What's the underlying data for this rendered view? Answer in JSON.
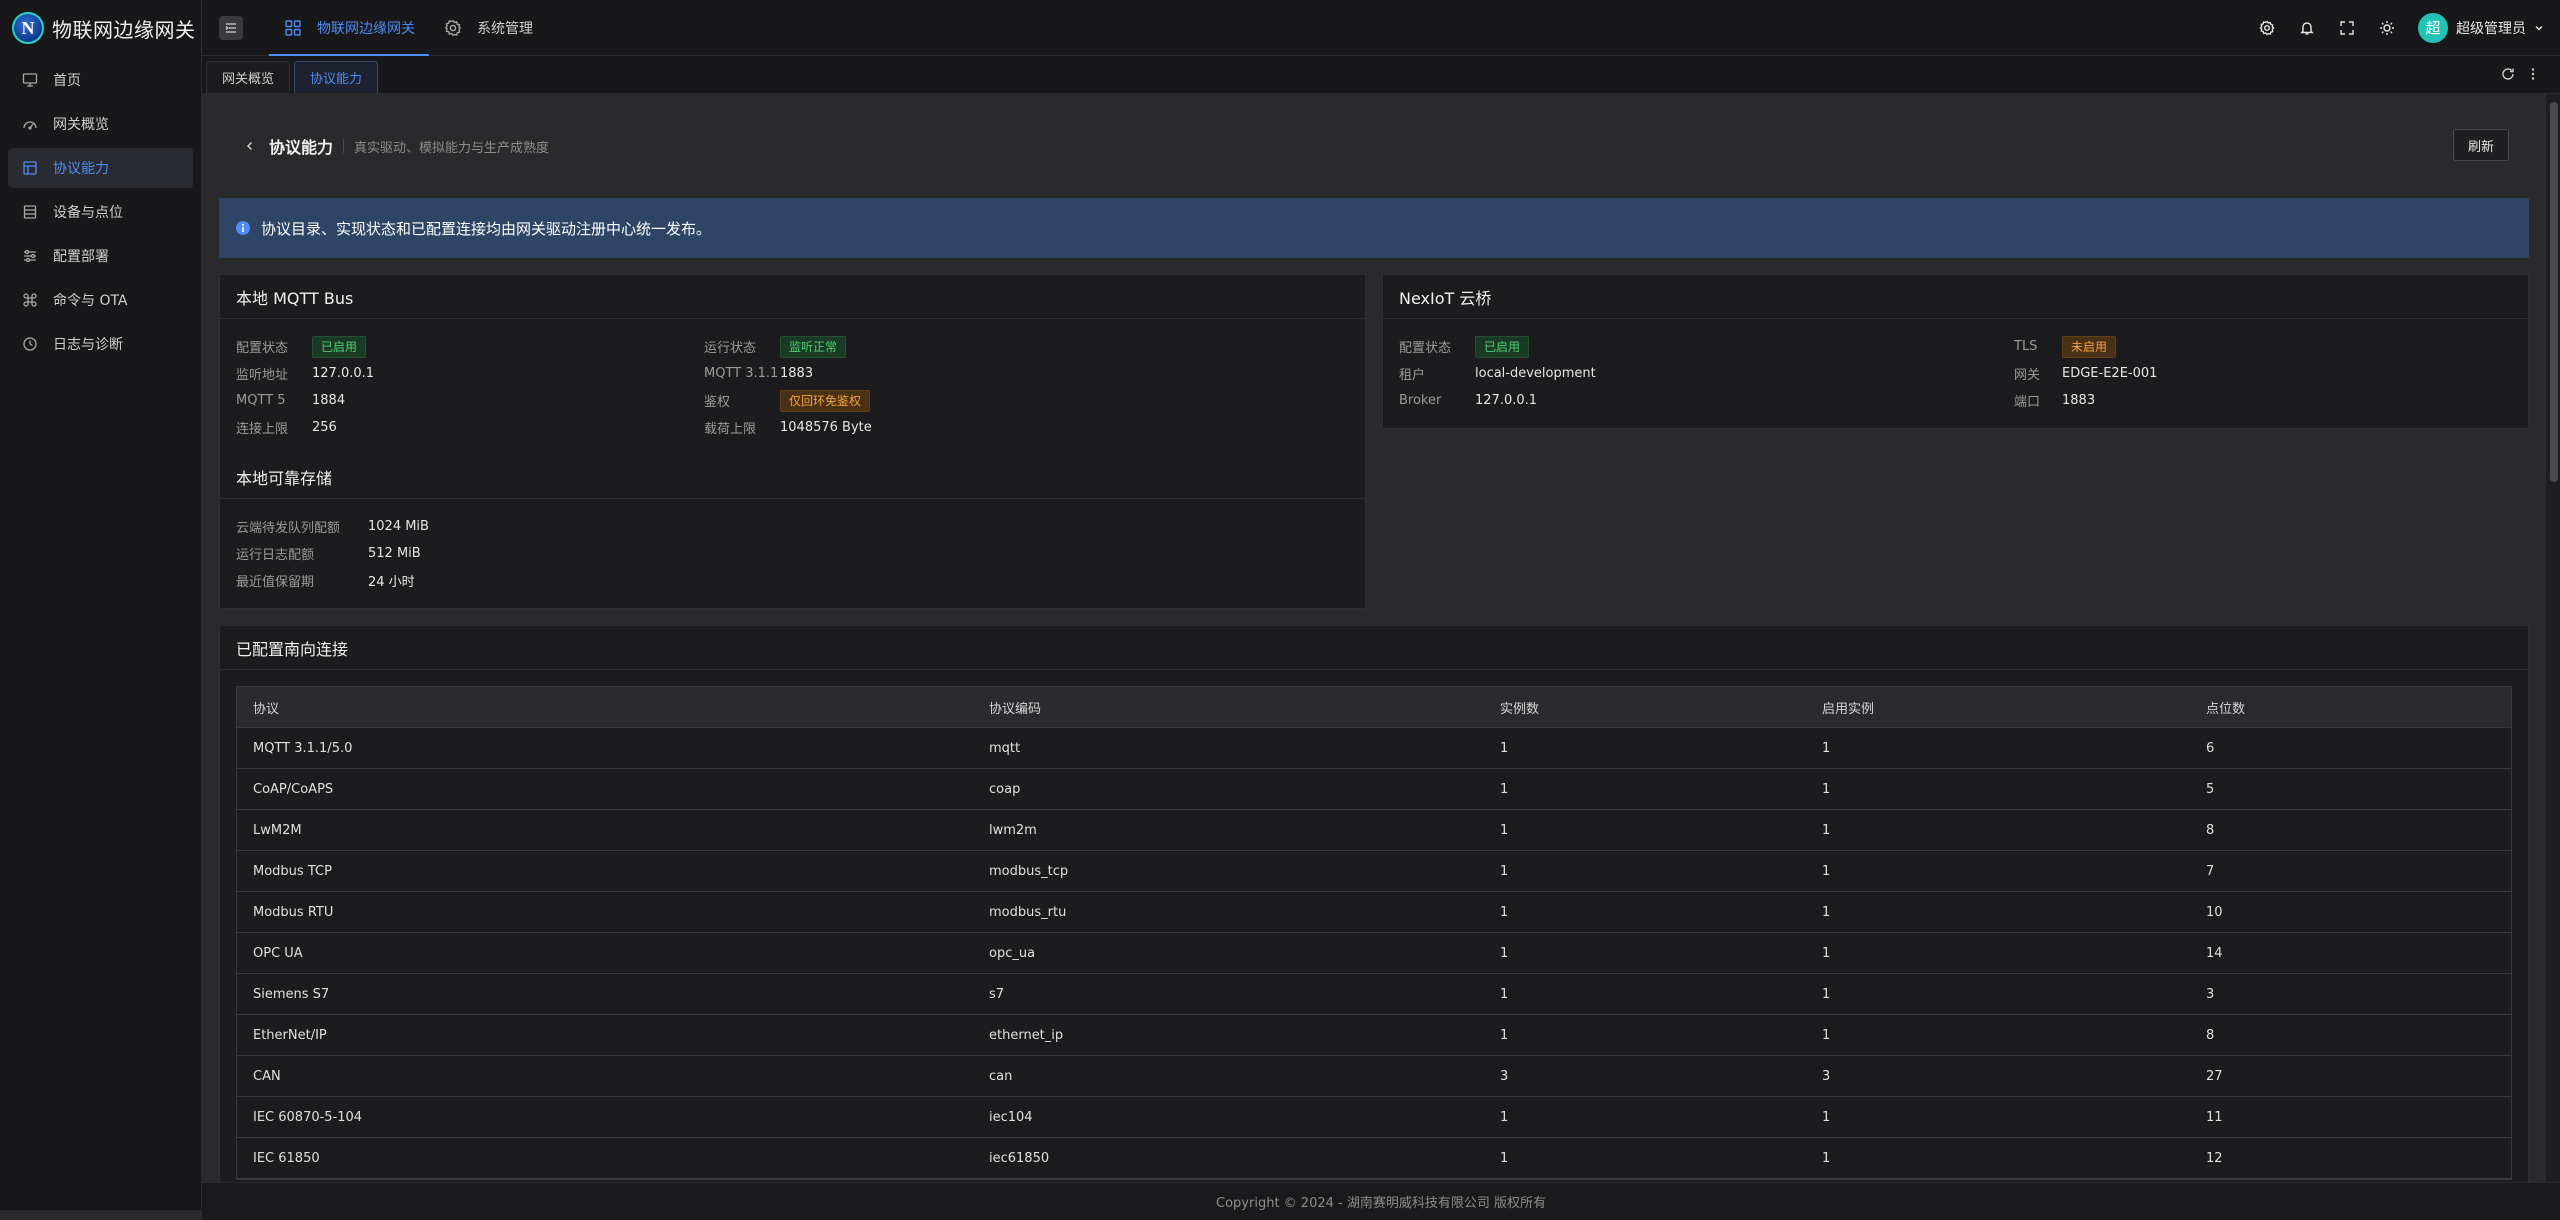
{
  "app": {
    "brand_logo_letter": "N",
    "brand_title": "物联网边缘网关"
  },
  "sidebar": {
    "items": [
      {
        "label": "首页",
        "icon": "monitor-icon"
      },
      {
        "label": "网关概览",
        "icon": "gauge-icon"
      },
      {
        "label": "协议能力",
        "icon": "layout-icon",
        "active": true
      },
      {
        "label": "设备与点位",
        "icon": "database-icon"
      },
      {
        "label": "配置部署",
        "icon": "sliders-icon"
      },
      {
        "label": "命令与 OTA",
        "icon": "command-icon"
      },
      {
        "label": "日志与诊断",
        "icon": "history-icon"
      }
    ]
  },
  "header": {
    "nav": [
      {
        "label": "物联网边缘网关",
        "icon": "grid-icon",
        "active": true
      },
      {
        "label": "系统管理",
        "icon": "gear-icon",
        "active": false
      }
    ],
    "user": {
      "avatar_letter": "超",
      "name": "超级管理员"
    }
  },
  "tabs": [
    {
      "label": "网关概览",
      "active": false
    },
    {
      "label": "协议能力",
      "active": true
    }
  ],
  "page": {
    "title": "协议能力",
    "subtitle": "真实驱动、模拟能力与生产成熟度",
    "refresh_label": "刷新",
    "alert": "协议目录、实现状态和已配置连接均由网关驱动注册中心统一发布。"
  },
  "mqtt_card": {
    "title": "本地 MQTT Bus",
    "fields": [
      {
        "label": "配置状态",
        "value": "已启用",
        "type": "badge",
        "color": "green"
      },
      {
        "label": "运行状态",
        "value": "监听正常",
        "type": "badge",
        "color": "green"
      },
      {
        "label": "监听地址",
        "value": "127.0.0.1"
      },
      {
        "label": "MQTT 3.1.1",
        "value": "1883"
      },
      {
        "label": "MQTT 5",
        "value": "1884"
      },
      {
        "label": "鉴权",
        "value": "仅回环免鉴权",
        "type": "badge",
        "color": "orange"
      },
      {
        "label": "连接上限",
        "value": "256"
      },
      {
        "label": "载荷上限",
        "value": "1048576 Byte"
      }
    ]
  },
  "storage_card": {
    "title": "本地可靠存储",
    "fields": [
      {
        "label": "云端待发队列配额",
        "value": "1024 MiB"
      },
      {
        "label": "运行日志配额",
        "value": "512 MiB"
      },
      {
        "label": "最近值保留期",
        "value": "24 小时"
      }
    ]
  },
  "nexiot_card": {
    "title": "NexIoT 云桥",
    "fields": [
      {
        "label": "配置状态",
        "value": "已启用",
        "type": "badge",
        "color": "green"
      },
      {
        "label": "TLS",
        "value": "未启用",
        "type": "badge",
        "color": "orange"
      },
      {
        "label": "租户",
        "value": "local-development"
      },
      {
        "label": "网关",
        "value": "EDGE-E2E-001"
      },
      {
        "label": "Broker",
        "value": "127.0.0.1"
      },
      {
        "label": "端口",
        "value": "1883"
      }
    ]
  },
  "connections": {
    "title": "已配置南向连接",
    "columns": [
      "协议",
      "协议编码",
      "实例数",
      "启用实例",
      "点位数"
    ],
    "rows": [
      [
        "MQTT 3.1.1/5.0",
        "mqtt",
        "1",
        "1",
        "6"
      ],
      [
        "CoAP/CoAPS",
        "coap",
        "1",
        "1",
        "5"
      ],
      [
        "LwM2M",
        "lwm2m",
        "1",
        "1",
        "8"
      ],
      [
        "Modbus TCP",
        "modbus_tcp",
        "1",
        "1",
        "7"
      ],
      [
        "Modbus RTU",
        "modbus_rtu",
        "1",
        "1",
        "10"
      ],
      [
        "OPC UA",
        "opc_ua",
        "1",
        "1",
        "14"
      ],
      [
        "Siemens S7",
        "s7",
        "1",
        "1",
        "3"
      ],
      [
        "EtherNet/IP",
        "ethernet_ip",
        "1",
        "1",
        "8"
      ],
      [
        "CAN",
        "can",
        "3",
        "3",
        "27"
      ],
      [
        "IEC 60870-5-104",
        "iec104",
        "1",
        "1",
        "11"
      ],
      [
        "IEC 61850",
        "iec61850",
        "1",
        "1",
        "12"
      ]
    ]
  },
  "footer": {
    "copyright": "Copyright © 2024 - 湖南赛明威科技有限公司 版权所有"
  },
  "colors": {
    "accent": "#4e8cf5",
    "alert_bg": "#2f4566",
    "badge_green": "#4fcf71",
    "badge_orange": "#f5a540",
    "avatar": "#22c3b4"
  }
}
